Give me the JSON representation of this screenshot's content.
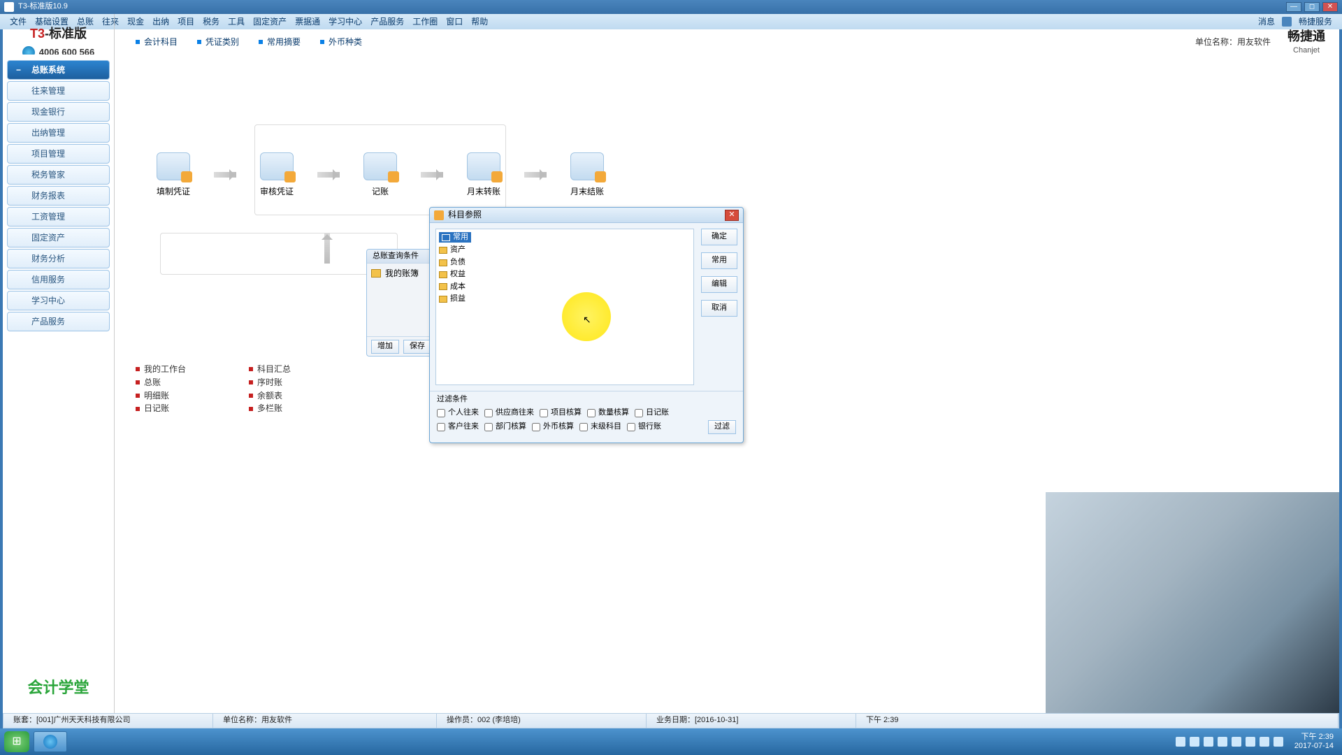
{
  "window": {
    "title": "T3-标准版10.9"
  },
  "menubar": {
    "items": [
      "文件",
      "基础设置",
      "总账",
      "往来",
      "现金",
      "出纳",
      "项目",
      "税务",
      "工具",
      "固定资产",
      "票据通",
      "学习中心",
      "产品服务",
      "工作圈",
      "窗口",
      "帮助"
    ],
    "right": {
      "msg": "消息",
      "svc": "畅捷服务"
    }
  },
  "brand": {
    "name_prefix": "T3",
    "name_suffix": "-标准版",
    "phone": "4006 600 566",
    "footer": "会计学堂"
  },
  "subbar": {
    "items": [
      "会计科目",
      "凭证类别",
      "常用摘要",
      "外币种类"
    ],
    "unit_label": "单位名称：",
    "unit_name": "用友软件",
    "logo": {
      "l1": "畅捷通",
      "l2": "Chanjet"
    }
  },
  "sidebar": {
    "items": [
      "总账系统",
      "往来管理",
      "现金银行",
      "出纳管理",
      "项目管理",
      "税务管家",
      "财务报表",
      "工资管理",
      "固定资产",
      "财务分析",
      "信用服务",
      "学习中心",
      "产品服务"
    ],
    "active": 0
  },
  "flow": {
    "nodes": [
      "填制凭证",
      "审核凭证",
      "记账",
      "月末转账",
      "月末结账"
    ]
  },
  "links": {
    "col1": [
      "我的工作台",
      "总账",
      "明细账",
      "日记账"
    ],
    "col2": [
      "科目汇总",
      "序时账",
      "余额表",
      "多栏账"
    ]
  },
  "panel1": {
    "title": "总账查询条件",
    "tree_root": "我的账簿",
    "btn_add": "增加",
    "btn_save": "保存"
  },
  "dialog": {
    "title": "科目参照",
    "tree": [
      "常用",
      "资产",
      "负债",
      "权益",
      "成本",
      "损益"
    ],
    "selected_index": 0,
    "buttons": {
      "ok": "确定",
      "common": "常用",
      "edit": "编辑",
      "cancel": "取消"
    },
    "filter": {
      "title": "过滤条件",
      "row1": [
        "个人往来",
        "供应商往来",
        "项目核算",
        "数量核算",
        "日记账"
      ],
      "row2": [
        "客户往来",
        "部门核算",
        "外币核算",
        "末级科目",
        "银行账"
      ],
      "go": "过滤"
    }
  },
  "statusbar": {
    "c1": "账套：[001]广州天天科技有限公司",
    "c2": "单位名称：用友软件",
    "c3": "操作员：002 (李培培)",
    "c4": "业务日期：[2016-10-31]",
    "c5": "下午 2:39"
  },
  "taskbar": {
    "clock_time": "下午 2:39",
    "clock_date": "2017-07-14"
  }
}
